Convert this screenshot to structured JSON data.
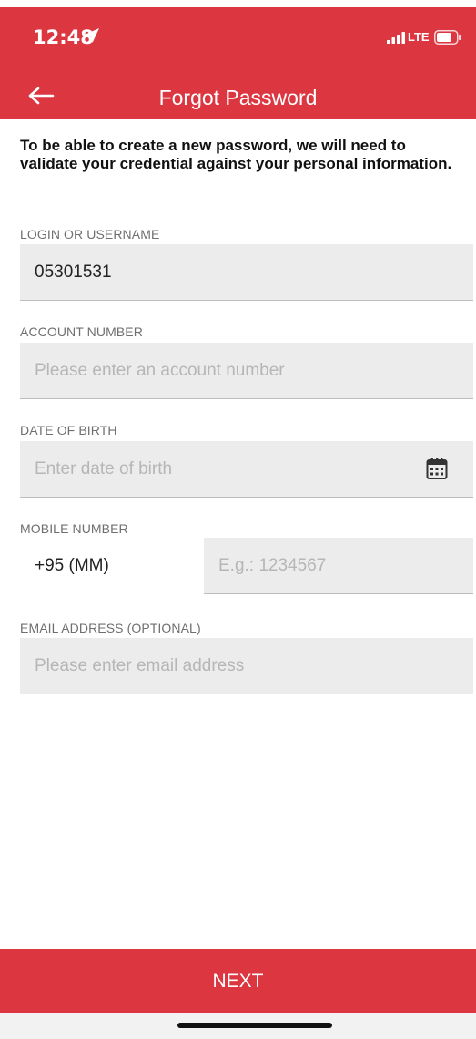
{
  "status_bar": {
    "time": "12:48",
    "network": "LTE",
    "icons": [
      "location-arrow-icon",
      "signal-bars-icon",
      "battery-icon"
    ]
  },
  "app_bar": {
    "title": "Forgot Password",
    "back_icon": "arrow-left-icon",
    "background_color": "#dc3640"
  },
  "intro_text": "To be able to create a new password, we will need to validate your credential against your personal information.",
  "form": {
    "login": {
      "label": "LOGIN OR USERNAME",
      "value": "05301531"
    },
    "account_number": {
      "label": "ACCOUNT NUMBER",
      "placeholder": "Please enter an account number"
    },
    "date_of_birth": {
      "label": "DATE OF BIRTH",
      "placeholder": "Enter date of birth",
      "icon": "calendar-icon"
    },
    "mobile": {
      "label": "MOBILE NUMBER",
      "prefix": "+95 (MM)",
      "placeholder": "E.g.: 1234567"
    },
    "email": {
      "label": "EMAIL ADDRESS (OPTIONAL)",
      "placeholder": "Please enter email address"
    }
  },
  "footer": {
    "next_label": "NEXT",
    "accent_color": "#dc3640"
  }
}
